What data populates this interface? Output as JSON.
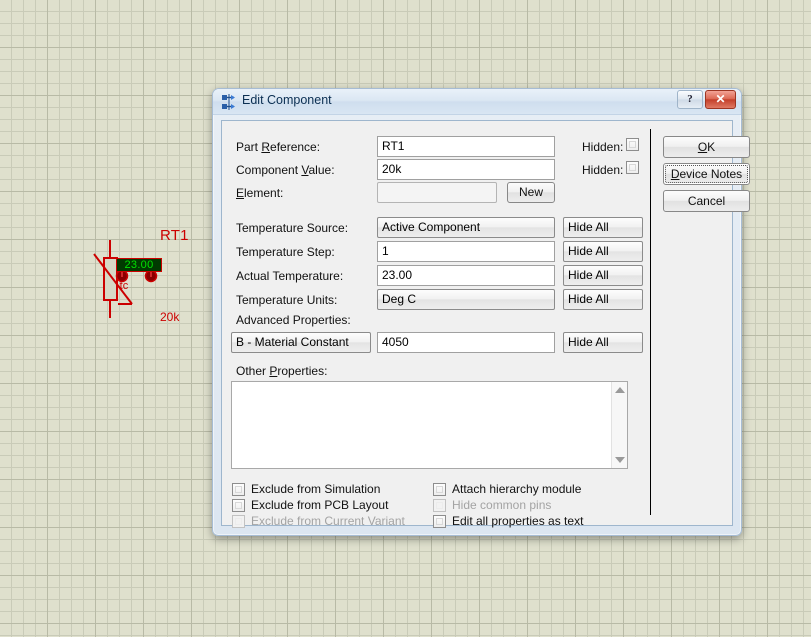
{
  "schematic": {
    "component": {
      "reference": "RT1",
      "value": "20k",
      "temperature_display": "23.00",
      "tc_label": "-tc",
      "ref_color": "#cc0000",
      "display_bg": "#003a00",
      "display_fg": "#00e000"
    }
  },
  "dialog": {
    "title": "Edit Component",
    "icon": "component-icon",
    "window_buttons": {
      "help": "?",
      "close": "✕"
    },
    "fields": {
      "part_reference": {
        "label": "Part Reference:",
        "label_accel": "R",
        "value": "RT1",
        "hidden_label": "Hidden:",
        "hidden_checked": false
      },
      "component_value": {
        "label": "Component Value:",
        "label_accel": "V",
        "value": "20k",
        "hidden_label": "Hidden:",
        "hidden_checked": false
      },
      "element": {
        "label": "Element:",
        "label_accel": "E",
        "value": "",
        "new_button": "New",
        "disabled": true
      },
      "temperature_source": {
        "label": "Temperature Source:",
        "value": "Active Component",
        "hide": "Hide All"
      },
      "temperature_step": {
        "label": "Temperature Step:",
        "value": "1",
        "hide": "Hide All"
      },
      "actual_temperature": {
        "label": "Actual Temperature:",
        "value": "23.00",
        "hide": "Hide All"
      },
      "temperature_units": {
        "label": "Temperature Units:",
        "value": "Deg C",
        "hide": "Hide All"
      },
      "advanced_properties": {
        "label": "Advanced Properties:",
        "property": "B - Material Constant",
        "value": "4050",
        "hide": "Hide All"
      },
      "other_properties": {
        "label": "Other Properties:",
        "label_accel": "P",
        "value": ""
      }
    },
    "checkboxes": [
      {
        "label": "Exclude from Simulation",
        "checked": false,
        "disabled": false
      },
      {
        "label": "Exclude from PCB Layout",
        "checked": false,
        "disabled": false
      },
      {
        "label": "Exclude from Current Variant",
        "checked": false,
        "disabled": true
      },
      {
        "label": "Attach hierarchy module",
        "checked": false,
        "disabled": false
      },
      {
        "label": "Hide common pins",
        "checked": false,
        "disabled": true
      },
      {
        "label": "Edit all properties as text",
        "checked": false,
        "disabled": false
      }
    ],
    "buttons": {
      "ok": "OK",
      "ok_accel": "O",
      "device_notes": "Device Notes",
      "device_notes_accel": "D",
      "cancel": "Cancel"
    }
  }
}
